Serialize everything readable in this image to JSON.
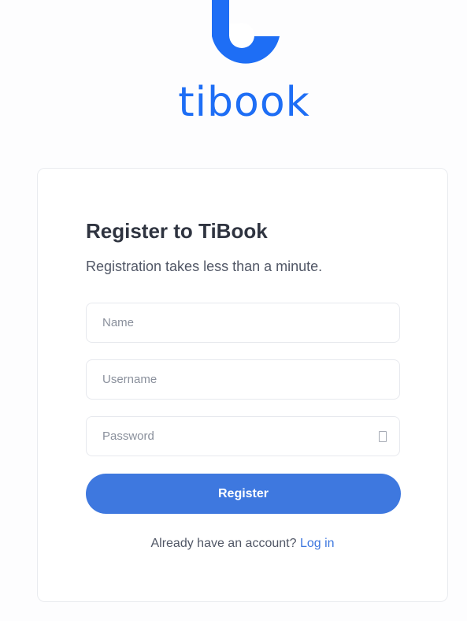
{
  "brand": {
    "name": "tibook",
    "color": "#1e6ef5",
    "logo_icon": "tibook-logo-icon"
  },
  "card": {
    "title": "Register to TiBook",
    "subtitle": "Registration takes less than a minute."
  },
  "form": {
    "name_placeholder": "Name",
    "name_value": "",
    "username_placeholder": "Username",
    "username_value": "",
    "password_placeholder": "Password",
    "password_value": "",
    "password_toggle_icon": "eye-icon",
    "submit_label": "Register",
    "submit_color": "#3e78df"
  },
  "footer": {
    "prompt": "Already have an account?",
    "login_label": "Log in",
    "link_color": "#3e78df"
  }
}
